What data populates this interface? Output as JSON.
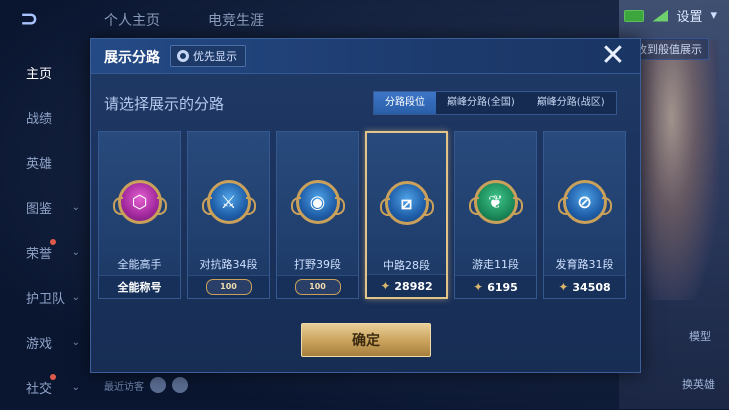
{
  "top_nav": [
    "个人主页",
    "电竞生涯"
  ],
  "top_right": {
    "settings_label": "设置"
  },
  "banner_label": "收到般值展示",
  "sidebar": {
    "items": [
      {
        "label": "主页"
      },
      {
        "label": "战绩"
      },
      {
        "label": "英雄"
      },
      {
        "label": "图鉴"
      },
      {
        "label": "荣誉"
      },
      {
        "label": "护卫队"
      },
      {
        "label": "游戏"
      },
      {
        "label": "社交"
      }
    ]
  },
  "recent_label": "最近访客",
  "right_labels": [
    "模型",
    "换英雄"
  ],
  "modal": {
    "title": "展示分路",
    "priority_label": "优先显示",
    "close_symbol": "✕",
    "subtitle": "请选择展示的分路",
    "tabs": [
      {
        "label": "分路段位",
        "active": true
      },
      {
        "label": "巅峰分路(全国)",
        "active": false
      },
      {
        "label": "巅峰分路(战区)",
        "active": false
      }
    ],
    "cards": [
      {
        "label": "全能高手",
        "bottom": "全能称号",
        "emblem": "all-round-emblem"
      },
      {
        "label": "对抗路34段",
        "bottom": "100",
        "emblem": "clash-lane-emblem"
      },
      {
        "label": "打野39段",
        "bottom": "100",
        "emblem": "jungle-emblem"
      },
      {
        "label": "中路28段",
        "bottom": "28982",
        "emblem": "mid-lane-emblem",
        "selected": true
      },
      {
        "label": "游走11段",
        "bottom": "6195",
        "emblem": "roam-emblem"
      },
      {
        "label": "发育路31段",
        "bottom": "34508",
        "emblem": "farm-lane-emblem"
      }
    ],
    "confirm_label": "确定"
  }
}
